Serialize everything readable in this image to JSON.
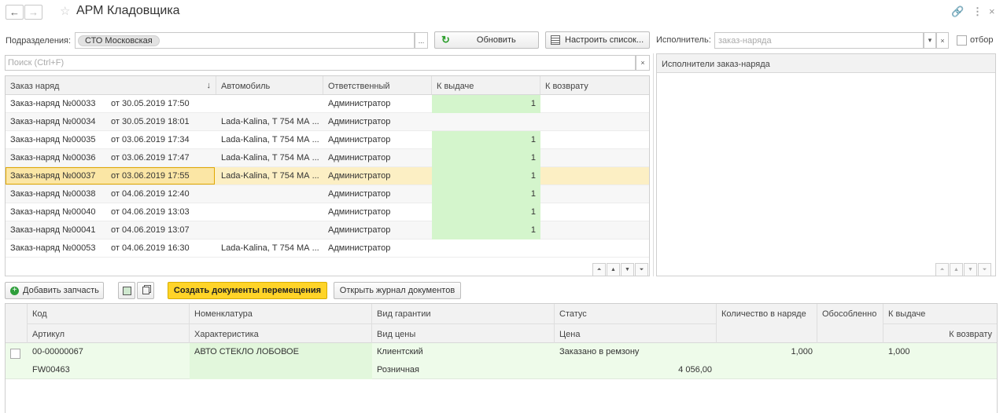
{
  "window": {
    "title": "АРМ Кладовщика"
  },
  "filters": {
    "division_label": "Подразделения:",
    "division_value": "СТО Московская",
    "refresh_label": "Обновить",
    "configure_label": "Настроить список...",
    "executor_label": "Исполнитель:",
    "executor_placeholder": "заказ-наряда",
    "filter_label": "отбор",
    "search_placeholder": "Поиск (Ctrl+F)"
  },
  "orders": {
    "columns": [
      "Заказ наряд",
      "Автомобиль",
      "Ответственный",
      "К выдаче",
      "К возврату"
    ],
    "rows": [
      {
        "name": "Заказ-наряд №00033",
        "date": "от 30.05.2019 17:50",
        "car": "",
        "resp": "Администратор",
        "issue": "1",
        "ret": ""
      },
      {
        "name": "Заказ-наряд №00034",
        "date": "от 30.05.2019 18:01",
        "car": "Lada-Kalina, Т 754 МА ...",
        "resp": "Администратор",
        "issue": "",
        "ret": ""
      },
      {
        "name": "Заказ-наряд №00035",
        "date": "от 03.06.2019 17:34",
        "car": "Lada-Kalina, Т 754 МА ...",
        "resp": "Администратор",
        "issue": "1",
        "ret": ""
      },
      {
        "name": "Заказ-наряд №00036",
        "date": "от 03.06.2019 17:47",
        "car": "Lada-Kalina, Т 754 МА ...",
        "resp": "Администратор",
        "issue": "1",
        "ret": ""
      },
      {
        "name": "Заказ-наряд №00037",
        "date": "от 03.06.2019 17:55",
        "car": "Lada-Kalina, Т 754 МА ...",
        "resp": "Администратор",
        "issue": "1",
        "ret": ""
      },
      {
        "name": "Заказ-наряд №00038",
        "date": "от 04.06.2019 12:40",
        "car": "",
        "resp": "Администратор",
        "issue": "1",
        "ret": ""
      },
      {
        "name": "Заказ-наряд №00040",
        "date": "от 04.06.2019 13:03",
        "car": "",
        "resp": "Администратор",
        "issue": "1",
        "ret": ""
      },
      {
        "name": "Заказ-наряд №00041",
        "date": "от 04.06.2019 13:07",
        "car": "",
        "resp": "Администратор",
        "issue": "1",
        "ret": ""
      },
      {
        "name": "Заказ-наряд №00053",
        "date": "от 04.06.2019 16:30",
        "car": "Lada-Kalina, Т 754 МА ...",
        "resp": "Администратор",
        "issue": "",
        "ret": ""
      }
    ]
  },
  "executors": {
    "header": "Исполнители заказ-наряда"
  },
  "toolbar": {
    "add_part_label": "Добавить запчасть",
    "create_docs_label": "Создать документы перемещения",
    "open_journal_label": "Открыть журнал документов"
  },
  "parts": {
    "header_top": [
      "Код",
      "Номенклатура",
      "Вид гарантии",
      "Статус",
      "Количество в наряде",
      "Обособленно",
      "К выдаче"
    ],
    "header_bottom": [
      "Артикул",
      "Характеристика",
      "Вид цены",
      "Цена",
      "К возврату"
    ],
    "rows": [
      {
        "code": "00-00000067",
        "article": "FW00463",
        "name": "АВТО СТЕКЛО ЛОБОВОЕ",
        "characteristic": "",
        "warranty": "Клиентский",
        "price_type": "Розничная",
        "status": "Заказано в ремзону",
        "price": "4 056,00",
        "qty": "1,000",
        "separate": "",
        "issue": "1,000",
        "ret": ""
      }
    ]
  }
}
